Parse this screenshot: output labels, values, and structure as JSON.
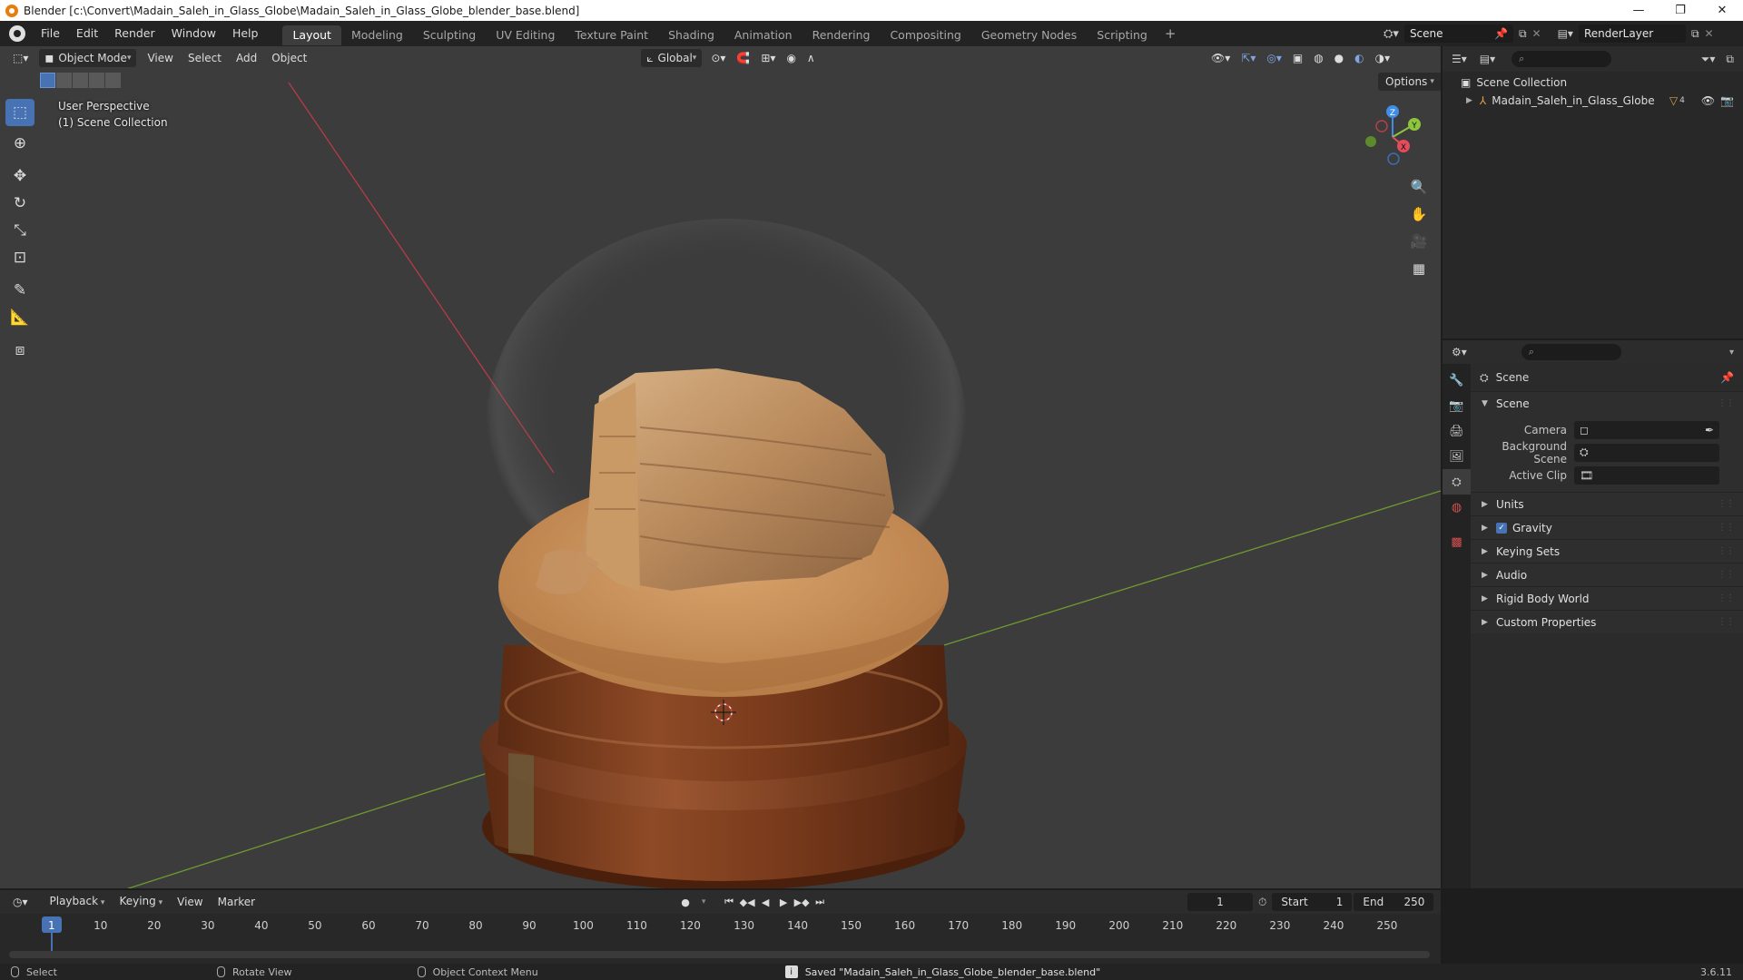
{
  "window": {
    "title": "Blender [c:\\Convert\\Madain_Saleh_in_Glass_Globe\\Madain_Saleh_in_Glass_Globe_blender_base.blend]",
    "controls": [
      "—",
      "❐",
      "✕"
    ]
  },
  "menubar": {
    "items": [
      "File",
      "Edit",
      "Render",
      "Window",
      "Help"
    ],
    "workspaces": [
      "Layout",
      "Modeling",
      "Sculpting",
      "UV Editing",
      "Texture Paint",
      "Shading",
      "Animation",
      "Rendering",
      "Compositing",
      "Geometry Nodes",
      "Scripting"
    ],
    "active_workspace": "Layout",
    "add_tab": "+",
    "scene_name": "Scene",
    "view_layer": "RenderLayer"
  },
  "viewport": {
    "mode": "Object Mode",
    "menus": [
      "View",
      "Select",
      "Add",
      "Object"
    ],
    "orientation": "Global",
    "options_label": "Options",
    "overlay_line1": "User Perspective",
    "overlay_line2": "(1) Scene Collection",
    "gizmo_axes": [
      "Z",
      "Y",
      "X"
    ]
  },
  "outliner": {
    "root": "Scene Collection",
    "object": "Madain_Saleh_in_Glass_Globe",
    "modifier_count": "4"
  },
  "properties": {
    "context_title": "Scene",
    "scene_panel": "Scene",
    "rows": [
      {
        "label": "Camera",
        "value": ""
      },
      {
        "label": "Background Scene",
        "value": ""
      },
      {
        "label": "Active Clip",
        "value": ""
      }
    ],
    "panels": [
      "Units",
      "Gravity",
      "Keying Sets",
      "Audio",
      "Rigid Body World",
      "Custom Properties"
    ],
    "gravity_checked": true
  },
  "timeline": {
    "menus": [
      "Playback",
      "Keying",
      "View",
      "Marker"
    ],
    "current_frame": "1",
    "start_label": "Start",
    "start_value": "1",
    "end_label": "End",
    "end_value": "250",
    "ruler": [
      "1",
      "10",
      "20",
      "30",
      "40",
      "50",
      "60",
      "70",
      "80",
      "90",
      "100",
      "110",
      "120",
      "130",
      "140",
      "150",
      "160",
      "170",
      "180",
      "190",
      "200",
      "210",
      "220",
      "230",
      "240",
      "250"
    ]
  },
  "statusbar": {
    "select": "Select",
    "rotate": "Rotate View",
    "context_menu": "Object Context Menu",
    "message": "Saved \"Madain_Saleh_in_Glass_Globe_blender_base.blend\"",
    "version": "3.6.11"
  },
  "colors": {
    "accent": "#4772b3",
    "x_axis": "#e54c5b",
    "y_axis": "#8cc63f",
    "z_axis": "#3f8de6",
    "wood": "#7a3b1c",
    "sand": "#c8915c"
  }
}
